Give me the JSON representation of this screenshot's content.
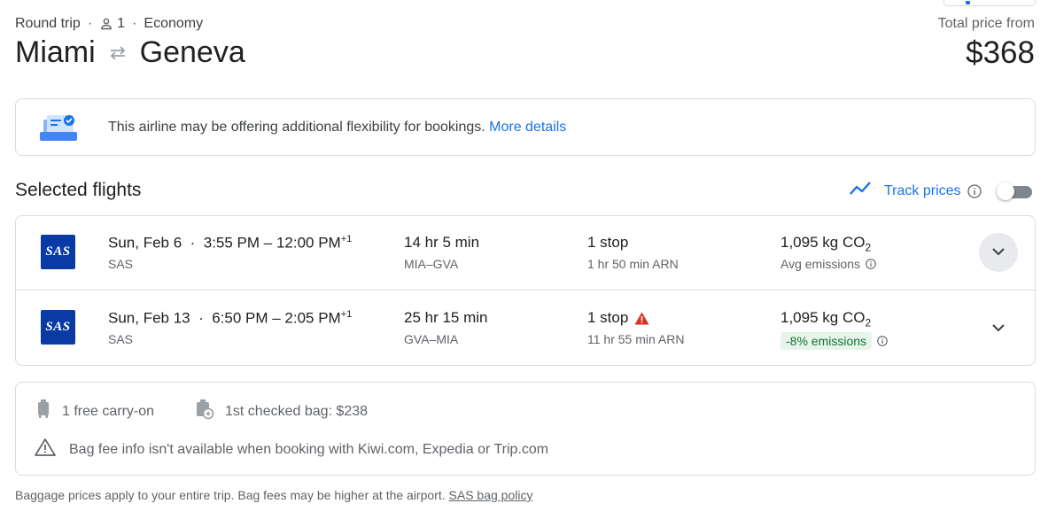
{
  "trip": {
    "type": "Round trip",
    "passengers": "1",
    "cabin": "Economy",
    "origin": "Miami",
    "destination": "Geneva",
    "price_label": "Total price from",
    "price": "$368"
  },
  "banner": {
    "text": "This airline may be offering additional flexibility for bookings.",
    "link": "More details"
  },
  "selected": {
    "title": "Selected flights",
    "track_label": "Track prices",
    "track_enabled": false
  },
  "flights": [
    {
      "logo": "SAS",
      "date": "Sun, Feb 6",
      "time": "3:55 PM – 12:00 PM",
      "day_offset": "+1",
      "airline": "SAS",
      "duration": "14 hr 5 min",
      "route": "MIA–GVA",
      "stops": "1 stop",
      "layover": "1 hr 50 min ARN",
      "co2_value": "1,095 kg CO",
      "co2_sub": "2",
      "emissions": "Avg emissions",
      "warning": false
    },
    {
      "logo": "SAS",
      "date": "Sun, Feb 13",
      "time": "6:50 PM – 2:05 PM",
      "day_offset": "+1",
      "airline": "SAS",
      "duration": "25 hr 15 min",
      "route": "GVA–MIA",
      "stops": "1 stop",
      "layover": "11 hr 55 min ARN",
      "co2_value": "1,095 kg CO",
      "co2_sub": "2",
      "emissions": "-8% emissions",
      "warning": true
    }
  ],
  "bags": {
    "carry_on": "1 free carry-on",
    "checked": "1st checked bag: $238",
    "note": "Bag fee info isn't available when booking with Kiwi.com, Expedia or Trip.com"
  },
  "footer": {
    "text": "Baggage prices apply to your entire trip. Bag fees may be higher at the airport.",
    "link": "SAS bag policy"
  },
  "colors": {
    "accent": "#1a73e8",
    "sas_blue": "#0a3aa6",
    "warning": "#d93025",
    "emission_badge_bg": "#e6f4ea",
    "emission_badge_text": "#137333"
  },
  "icons": [
    "person-icon",
    "swap-arrows-icon",
    "flexibility-illustration-icon",
    "trend-line-icon",
    "info-icon",
    "chevron-down-icon",
    "warning-triangle-icon",
    "carry-on-bag-icon",
    "checked-bag-icon",
    "alert-triangle-outline-icon"
  ]
}
